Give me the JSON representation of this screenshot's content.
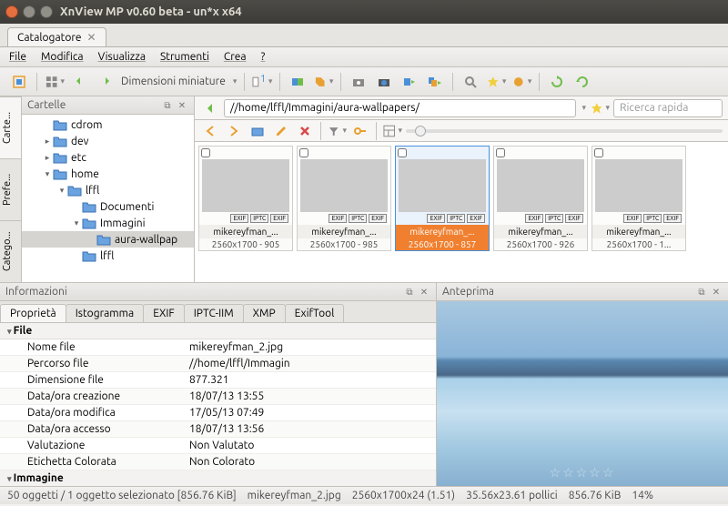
{
  "window": {
    "title": "XnView MP v0.60 beta - un*x x64"
  },
  "tab": {
    "label": "Catalogatore"
  },
  "menu": {
    "file": "File",
    "modifica": "Modifica",
    "visualizza": "Visualizza",
    "strumenti": "Strumenti",
    "crea": "Crea",
    "help": "?"
  },
  "toolbar": {
    "thumbsize": "Dimensioni miniature"
  },
  "sidetabs": {
    "cartelle": "Carte...",
    "preferiti": "Prefe...",
    "categorie": "Catego..."
  },
  "tree": {
    "title": "Cartelle",
    "items": [
      {
        "label": "cdrom",
        "depth": 1,
        "expand": ""
      },
      {
        "label": "dev",
        "depth": 1,
        "expand": "▸"
      },
      {
        "label": "etc",
        "depth": 1,
        "expand": "▸"
      },
      {
        "label": "home",
        "depth": 1,
        "expand": "▾"
      },
      {
        "label": "lffl",
        "depth": 2,
        "expand": "▾"
      },
      {
        "label": "Documenti",
        "depth": 3,
        "expand": ""
      },
      {
        "label": "Immagini",
        "depth": 3,
        "expand": "▾"
      },
      {
        "label": "aura-wallpap",
        "depth": 4,
        "expand": "",
        "sel": true
      },
      {
        "label": "lffl",
        "depth": 3,
        "expand": ""
      }
    ]
  },
  "path": {
    "value": "//home/lffl/Immagini/aura-wallpapers/"
  },
  "search": {
    "placeholder": "Ricerca rapida"
  },
  "thumbs": [
    {
      "cap": "mikereyfman_...",
      "dim": "2560x1700 - 905",
      "cls": "img-mt"
    },
    {
      "cap": "mikereyfman_...",
      "dim": "2560x1700 - 985",
      "cls": "img-lk"
    },
    {
      "cap": "mikereyfman_...",
      "dim": "2560x1700 - 857",
      "cls": "img-ic",
      "sel": true
    },
    {
      "cap": "mikereyfman_...",
      "dim": "2560x1700 - 926",
      "cls": "img-vl"
    },
    {
      "cap": "mikereyfman_...",
      "dim": "2560x1700 - 1...",
      "cls": "img-cr"
    }
  ],
  "info": {
    "title": "Informazioni",
    "tabs": [
      "Proprietà",
      "Istogramma",
      "EXIF",
      "IPTC-IIM",
      "XMP",
      "ExifTool"
    ],
    "groups": [
      {
        "name": "File",
        "rows": [
          {
            "k": "Nome file",
            "v": "mikereyfman_2.jpg"
          },
          {
            "k": "Percorso file",
            "v": "//home/lffl/Immagin"
          },
          {
            "k": "Dimensione file",
            "v": "877.321"
          },
          {
            "k": "Data/ora creazione",
            "v": "18/07/13 13:55"
          },
          {
            "k": "Data/ora modifica",
            "v": "17/05/13 07:49"
          },
          {
            "k": "Data/ora accesso",
            "v": "18/07/13 13:56"
          },
          {
            "k": "Valutazione",
            "v": "Non Valutato"
          },
          {
            "k": "Etichetta Colorata",
            "v": "Non Colorato"
          }
        ]
      },
      {
        "name": "Immagine",
        "rows": []
      }
    ]
  },
  "preview": {
    "title": "Anteprima",
    "stars": "☆☆☆☆☆"
  },
  "status": {
    "sel": "50 oggetti / 1 oggetto selezionato [856.76 KiB]",
    "file": "mikereyfman_2.jpg",
    "dim": "2560x1700x24 (1.51)",
    "inch": "35.56x23.61 pollici",
    "size": "856.76 KiB",
    "zoom": "14%"
  }
}
